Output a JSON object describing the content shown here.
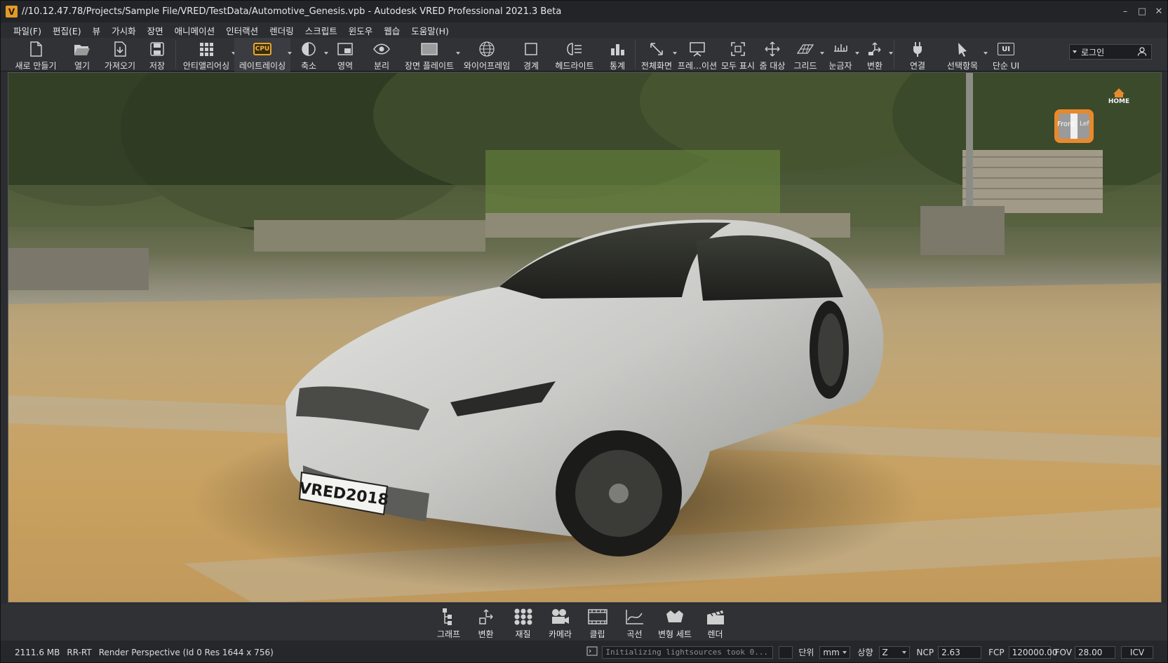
{
  "window": {
    "title": "//10.12.47.78/Projects/Sample File/VRED/TestData/Automotive_Genesis.vpb - Autodesk VRED Professional 2021.3 Beta",
    "logo": "V"
  },
  "menu": [
    "파일(F)",
    "편집(E)",
    "뷰",
    "가시화",
    "장면",
    "애니메이션",
    "인터랙션",
    "렌더링",
    "스크립트",
    "윈도우",
    "웹습",
    "도움말(H)"
  ],
  "toolbar": [
    {
      "label": "새로 만들기",
      "icon": "new-file-icon"
    },
    {
      "label": "열기",
      "icon": "folder-open-icon"
    },
    {
      "label": "가져오기",
      "icon": "import-icon"
    },
    {
      "label": "저장",
      "icon": "save-icon"
    },
    {
      "label": "안티앨리어싱",
      "icon": "antialiasing-icon"
    },
    {
      "label": "레이트레이싱",
      "icon": "cpu-raytracing-icon",
      "badge": "CPU"
    },
    {
      "label": "축소",
      "icon": "half-circle-icon"
    },
    {
      "label": "영역",
      "icon": "region-icon"
    },
    {
      "label": "분리",
      "icon": "eye-icon"
    },
    {
      "label": "장면 플레이트",
      "icon": "scene-plate-icon"
    },
    {
      "label": "와이어프레임",
      "icon": "globe-wireframe-icon"
    },
    {
      "label": "경계",
      "icon": "bounds-icon"
    },
    {
      "label": "헤드라이트",
      "icon": "headlight-icon"
    },
    {
      "label": "통계",
      "icon": "statistics-icon"
    },
    {
      "label": "전체화면",
      "icon": "fullscreen-icon"
    },
    {
      "label": "프레…이션",
      "icon": "presentation-icon"
    },
    {
      "label": "모두 표시",
      "icon": "show-all-icon"
    },
    {
      "label": "줌 대상",
      "icon": "zoom-target-icon"
    },
    {
      "label": "그리드",
      "icon": "grid-icon"
    },
    {
      "label": "눈금자",
      "icon": "ruler-icon"
    },
    {
      "label": "변환",
      "icon": "transform-icon"
    },
    {
      "label": "연결",
      "icon": "plug-icon"
    },
    {
      "label": "선택항목",
      "icon": "selection-icon"
    },
    {
      "label": "단순 UI",
      "icon": "simple-ui-icon",
      "badge": "UI"
    }
  ],
  "login": {
    "label": "로그인"
  },
  "viewcube": {
    "front": "Front",
    "left": "Left",
    "home": "HOME"
  },
  "license_plate": "VRED2018",
  "dock": [
    {
      "label": "그래프",
      "icon": "graph-icon"
    },
    {
      "label": "변환",
      "icon": "transform-icon"
    },
    {
      "label": "재질",
      "icon": "materials-icon"
    },
    {
      "label": "카메라",
      "icon": "camera-icon"
    },
    {
      "label": "클립",
      "icon": "clip-icon"
    },
    {
      "label": "곡선",
      "icon": "curves-icon"
    },
    {
      "label": "변형 세트",
      "icon": "variant-sets-icon"
    },
    {
      "label": "렌더",
      "icon": "render-clapper-icon"
    }
  ],
  "status": {
    "memory": "2111.6 MB",
    "mode": "RR-RT",
    "camera": "Render Perspective (Id 0 Res 1644 x 756)",
    "log": "Initializing lightsources took 0...",
    "unit_label": "단위",
    "unit_value": "mm",
    "up_label": "상향",
    "up_value": "Z",
    "ncp_label": "NCP",
    "ncp_value": "2.63",
    "fcp_label": "FCP",
    "fcp_value": "120000.00",
    "fov_label": "FOV",
    "fov_value": "28.00",
    "icv_label": "ICV"
  },
  "colors": {
    "accent": "#e8892c",
    "titlebar": "#232428",
    "panel": "#303236"
  }
}
